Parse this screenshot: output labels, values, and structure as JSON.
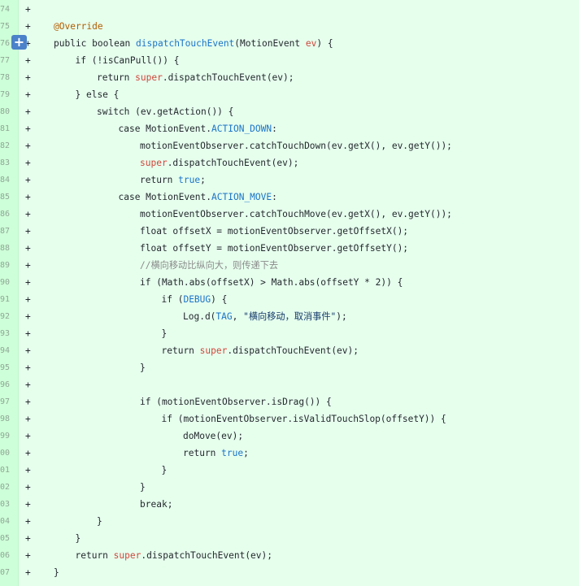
{
  "diff": {
    "add_button_label": "+",
    "lines": [
      {
        "num": "74",
        "sign": "+",
        "indent": 0,
        "tokens": []
      },
      {
        "num": "75",
        "sign": "+",
        "indent": 1,
        "tokens": [
          {
            "t": "@Override",
            "c": "tok-ann"
          }
        ]
      },
      {
        "num": "76",
        "sign": "+",
        "indent": 1,
        "tokens": [
          {
            "t": "public boolean ",
            "c": ""
          },
          {
            "t": "dispatchTouchEvent",
            "c": "tok-id"
          },
          {
            "t": "(MotionEvent ",
            "c": ""
          },
          {
            "t": "ev",
            "c": "tok-super"
          },
          {
            "t": ") {",
            "c": ""
          }
        ]
      },
      {
        "num": "77",
        "sign": "+",
        "indent": 2,
        "tokens": [
          {
            "t": "if (!isCanPull()) {",
            "c": ""
          }
        ]
      },
      {
        "num": "78",
        "sign": "+",
        "indent": 3,
        "tokens": [
          {
            "t": "return ",
            "c": ""
          },
          {
            "t": "super",
            "c": "tok-super"
          },
          {
            "t": ".dispatchTouchEvent(ev);",
            "c": ""
          }
        ]
      },
      {
        "num": "79",
        "sign": "+",
        "indent": 2,
        "tokens": [
          {
            "t": "} else {",
            "c": ""
          }
        ]
      },
      {
        "num": "80",
        "sign": "+",
        "indent": 3,
        "tokens": [
          {
            "t": "switch (ev.getAction()) {",
            "c": ""
          }
        ]
      },
      {
        "num": "81",
        "sign": "+",
        "indent": 4,
        "tokens": [
          {
            "t": "case MotionEvent.",
            "c": ""
          },
          {
            "t": "ACTION_DOWN",
            "c": "tok-id"
          },
          {
            "t": ":",
            "c": ""
          }
        ]
      },
      {
        "num": "82",
        "sign": "+",
        "indent": 5,
        "tokens": [
          {
            "t": "motionEventObserver.catchTouchDown(ev.getX(), ev.getY());",
            "c": ""
          }
        ]
      },
      {
        "num": "83",
        "sign": "+",
        "indent": 5,
        "tokens": [
          {
            "t": "super",
            "c": "tok-super"
          },
          {
            "t": ".dispatchTouchEvent(ev);",
            "c": ""
          }
        ]
      },
      {
        "num": "84",
        "sign": "+",
        "indent": 5,
        "tokens": [
          {
            "t": "return ",
            "c": ""
          },
          {
            "t": "true",
            "c": "tok-num"
          },
          {
            "t": ";",
            "c": ""
          }
        ]
      },
      {
        "num": "85",
        "sign": "+",
        "indent": 4,
        "tokens": [
          {
            "t": "case MotionEvent.",
            "c": ""
          },
          {
            "t": "ACTION_MOVE",
            "c": "tok-id"
          },
          {
            "t": ":",
            "c": ""
          }
        ]
      },
      {
        "num": "86",
        "sign": "+",
        "indent": 5,
        "tokens": [
          {
            "t": "motionEventObserver.catchTouchMove(ev.getX(), ev.getY());",
            "c": ""
          }
        ]
      },
      {
        "num": "87",
        "sign": "+",
        "indent": 5,
        "tokens": [
          {
            "t": "float offsetX = motionEventObserver.getOffsetX();",
            "c": ""
          }
        ]
      },
      {
        "num": "88",
        "sign": "+",
        "indent": 5,
        "tokens": [
          {
            "t": "float offsetY = motionEventObserver.getOffsetY();",
            "c": ""
          }
        ]
      },
      {
        "num": "89",
        "sign": "+",
        "indent": 5,
        "tokens": [
          {
            "t": "//横向移动比纵向大，则传递下去",
            "c": "tok-cm"
          }
        ]
      },
      {
        "num": "90",
        "sign": "+",
        "indent": 5,
        "tokens": [
          {
            "t": "if (Math.abs(offsetX) > Math.abs(offsetY * 2)) {",
            "c": ""
          }
        ]
      },
      {
        "num": "91",
        "sign": "+",
        "indent": 6,
        "tokens": [
          {
            "t": "if (",
            "c": ""
          },
          {
            "t": "DEBUG",
            "c": "tok-id"
          },
          {
            "t": ") {",
            "c": ""
          }
        ]
      },
      {
        "num": "92",
        "sign": "+",
        "indent": 7,
        "tokens": [
          {
            "t": "Log.d(",
            "c": ""
          },
          {
            "t": "TAG",
            "c": "tok-id"
          },
          {
            "t": ", ",
            "c": ""
          },
          {
            "t": "\"横向移动，取消事件\"",
            "c": "tok-str"
          },
          {
            "t": ");",
            "c": ""
          }
        ]
      },
      {
        "num": "93",
        "sign": "+",
        "indent": 6,
        "tokens": [
          {
            "t": "}",
            "c": ""
          }
        ]
      },
      {
        "num": "94",
        "sign": "+",
        "indent": 6,
        "tokens": [
          {
            "t": "return ",
            "c": ""
          },
          {
            "t": "super",
            "c": "tok-super"
          },
          {
            "t": ".dispatchTouchEvent(ev);",
            "c": ""
          }
        ]
      },
      {
        "num": "95",
        "sign": "+",
        "indent": 5,
        "tokens": [
          {
            "t": "}",
            "c": ""
          }
        ]
      },
      {
        "num": "96",
        "sign": "+",
        "indent": 0,
        "tokens": []
      },
      {
        "num": "97",
        "sign": "+",
        "indent": 5,
        "tokens": [
          {
            "t": "if (motionEventObserver.isDrag()) {",
            "c": ""
          }
        ]
      },
      {
        "num": "98",
        "sign": "+",
        "indent": 6,
        "tokens": [
          {
            "t": "if (motionEventObserver.isValidTouchSlop(offsetY)) {",
            "c": ""
          }
        ]
      },
      {
        "num": "99",
        "sign": "+",
        "indent": 7,
        "tokens": [
          {
            "t": "doMove(ev);",
            "c": ""
          }
        ]
      },
      {
        "num": "00",
        "sign": "+",
        "indent": 7,
        "tokens": [
          {
            "t": "return ",
            "c": ""
          },
          {
            "t": "true",
            "c": "tok-num"
          },
          {
            "t": ";",
            "c": ""
          }
        ]
      },
      {
        "num": "01",
        "sign": "+",
        "indent": 6,
        "tokens": [
          {
            "t": "}",
            "c": ""
          }
        ]
      },
      {
        "num": "02",
        "sign": "+",
        "indent": 5,
        "tokens": [
          {
            "t": "}",
            "c": ""
          }
        ]
      },
      {
        "num": "03",
        "sign": "+",
        "indent": 5,
        "tokens": [
          {
            "t": "break",
            "c": ""
          },
          {
            "t": ";",
            "c": ""
          }
        ]
      },
      {
        "num": "04",
        "sign": "+",
        "indent": 3,
        "tokens": [
          {
            "t": "}",
            "c": ""
          }
        ]
      },
      {
        "num": "05",
        "sign": "+",
        "indent": 2,
        "tokens": [
          {
            "t": "}",
            "c": ""
          }
        ]
      },
      {
        "num": "06",
        "sign": "+",
        "indent": 2,
        "tokens": [
          {
            "t": "return ",
            "c": ""
          },
          {
            "t": "super",
            "c": "tok-super"
          },
          {
            "t": ".dispatchTouchEvent(ev);",
            "c": ""
          }
        ]
      },
      {
        "num": "07",
        "sign": "+",
        "indent": 1,
        "tokens": [
          {
            "t": "}",
            "c": ""
          }
        ]
      }
    ]
  }
}
